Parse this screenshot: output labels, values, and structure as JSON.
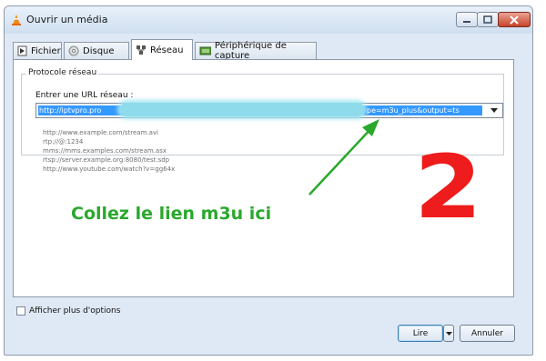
{
  "window": {
    "title": "Ouvrir un média"
  },
  "tabs": [
    {
      "label": "Fichier",
      "icon": "file-icon"
    },
    {
      "label": "Disque",
      "icon": "disc-icon"
    },
    {
      "label": "Réseau",
      "icon": "network-icon",
      "active": true
    },
    {
      "label": "Périphérique de capture",
      "icon": "capture-device-icon"
    }
  ],
  "network": {
    "group_title": "Protocole réseau",
    "url_label": "Entrer une URL réseau :",
    "url_start": "http://iptvpro.pro",
    "url_end": "pe=m3u_plus&output=ts",
    "examples": [
      "http://www.example.com/stream.avi",
      "rtp://@:1234",
      "mms://mms.examples.com/stream.asx",
      "rtsp://server.example.org:8080/test.sdp",
      "http://www.youtube.com/watch?v=gg64x"
    ]
  },
  "annotation": {
    "instruction": "Collez le lien m3u ici",
    "step": "2",
    "instruction_color": "#2aa82c",
    "step_color": "#ee1c1c"
  },
  "options": {
    "more_options_label": "Afficher plus d'options",
    "checked": false
  },
  "buttons": {
    "play": "Lire",
    "cancel": "Annuler"
  },
  "colors": {
    "selection": "#3399ff",
    "window_bg": "#dfe9f5"
  }
}
